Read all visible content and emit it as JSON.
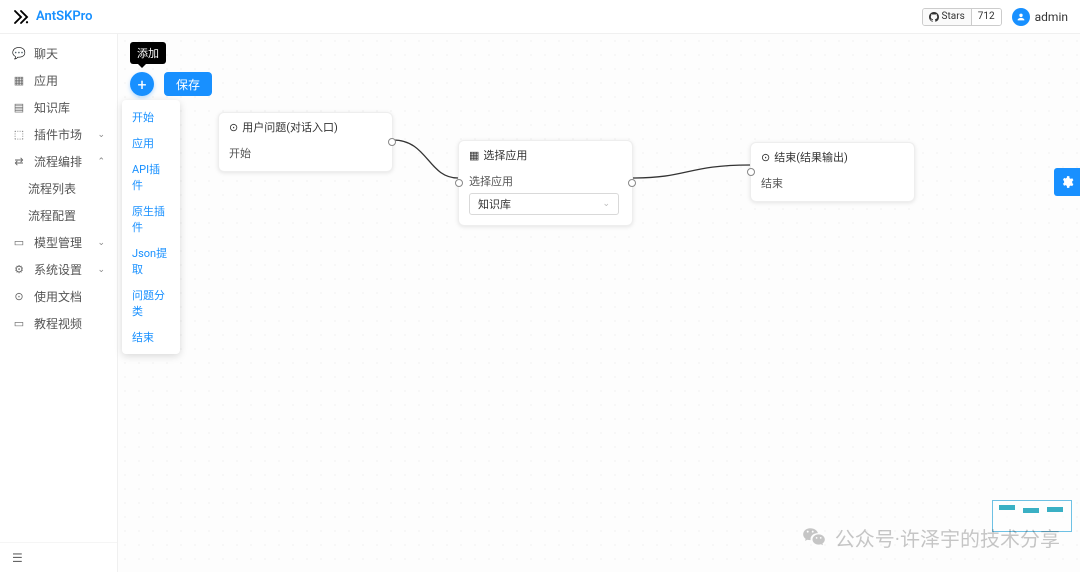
{
  "header": {
    "app_name": "AntSKPro",
    "github_label": "Stars",
    "github_count": "712",
    "user_name": "admin"
  },
  "sidebar": {
    "items": [
      {
        "icon": "💬",
        "label": "聊天",
        "arrow": ""
      },
      {
        "icon": "▦",
        "label": "应用",
        "arrow": ""
      },
      {
        "icon": "▤",
        "label": "知识库",
        "arrow": ""
      },
      {
        "icon": "⬚",
        "label": "插件市场",
        "arrow": "⌄"
      },
      {
        "icon": "⇄",
        "label": "流程编排",
        "arrow": "⌃"
      },
      {
        "icon": "▭",
        "label": "模型管理",
        "arrow": "⌄"
      },
      {
        "icon": "⚙",
        "label": "系统设置",
        "arrow": "⌄"
      },
      {
        "icon": "⊙",
        "label": "使用文档",
        "arrow": ""
      },
      {
        "icon": "▭",
        "label": "教程视频",
        "arrow": ""
      }
    ],
    "submenu_flow": [
      {
        "label": "流程列表"
      },
      {
        "label": "流程配置"
      }
    ]
  },
  "canvas": {
    "tooltip": "添加",
    "save_label": "保存",
    "dropdown": [
      "开始",
      "应用",
      "API插件",
      "原生插件",
      "Json提取",
      "问题分类",
      "结束"
    ],
    "node1": {
      "title": "用户问题(对话入口)",
      "body": "开始",
      "icon": "⊙"
    },
    "node2": {
      "title": "选择应用",
      "body": "选择应用",
      "select": "知识库",
      "icon": "▦"
    },
    "node3": {
      "title": "结束(结果输出)",
      "body": "结束",
      "icon": "⊙"
    },
    "watermark": "公众号·许泽宇的技术分享"
  }
}
